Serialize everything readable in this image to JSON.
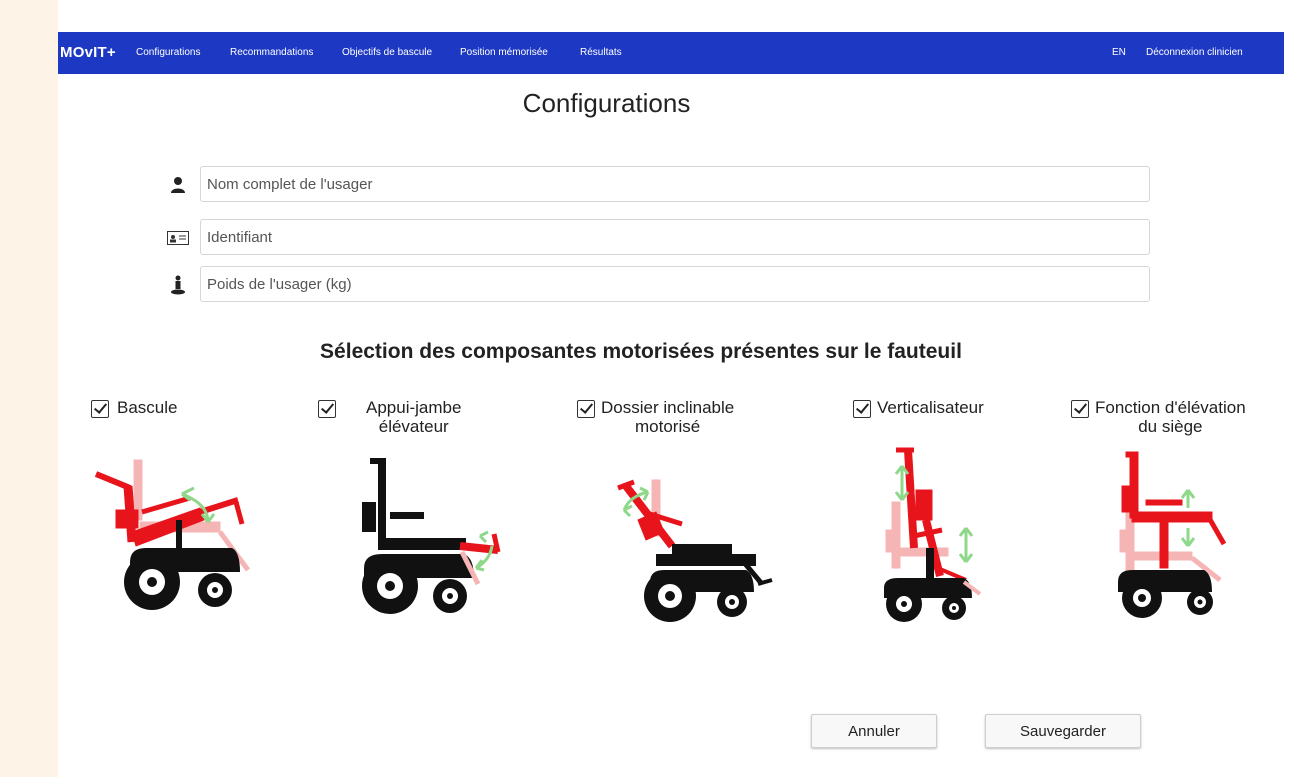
{
  "nav": {
    "brand": "MOvIT+",
    "items": [
      "Configurations",
      "Recommandations",
      "Objectifs de bascule",
      "Position mémorisée",
      "Résultats"
    ],
    "lang": "EN",
    "logout": "Déconnexion clinicien"
  },
  "page": {
    "title": "Configurations"
  },
  "form": {
    "name_placeholder": "Nom complet de l'usager",
    "id_placeholder": "Identifiant",
    "weight_placeholder": "Poids de l'usager (kg)"
  },
  "section_title": "Sélection des composantes motorisées présentes sur le fauteuil",
  "components": [
    {
      "label": "Bascule",
      "checked": true,
      "icon": "tilt-wheelchair-icon"
    },
    {
      "label": "Appui-jambe\nélévateur",
      "checked": true,
      "icon": "leg-rest-wheelchair-icon"
    },
    {
      "label": "Dossier inclinable\nmotorisé",
      "checked": true,
      "icon": "recline-wheelchair-icon"
    },
    {
      "label": "Verticalisateur",
      "checked": true,
      "icon": "standing-wheelchair-icon"
    },
    {
      "label": "Fonction d'élévation\ndu siège",
      "checked": true,
      "icon": "seat-elevation-wheelchair-icon"
    }
  ],
  "buttons": {
    "cancel": "Annuler",
    "save": "Sauvegarder"
  },
  "colors": {
    "nav_bg": "#1d39c4",
    "highlight_red": "#e8141c",
    "ghost_pink": "#f5b5b5",
    "arrow_green": "#8fd88a"
  }
}
